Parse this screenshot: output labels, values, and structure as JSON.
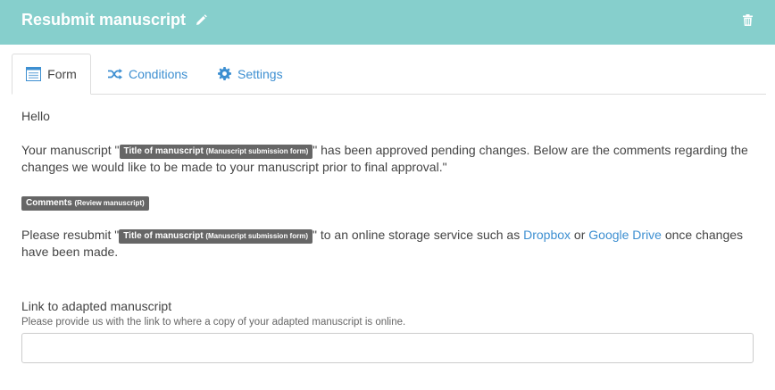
{
  "header": {
    "title": "Resubmit manuscript",
    "edit_icon": "pencil-icon",
    "delete_icon": "trash-icon",
    "background_color": "#86cfcc"
  },
  "tabs": [
    {
      "label": "Form",
      "icon": "form-list-icon",
      "active": true
    },
    {
      "label": "Conditions",
      "icon": "shuffle-icon",
      "active": false
    },
    {
      "label": "Settings",
      "icon": "gear-icon",
      "active": false
    }
  ],
  "body": {
    "greeting": "Hello",
    "para1": {
      "before": "Your manuscript \"",
      "tag_main": "Title of manuscript",
      "tag_sub": "(Manuscript submission form)",
      "after": "\" has been approved pending changes. Below are the comments regarding the changes we would like to be made to your manuscript prior to final approval.\""
    },
    "comments_tag": {
      "main": "Comments",
      "sub": "(Review manuscript)"
    },
    "para2": {
      "before": "Please resubmit \"",
      "tag_main": "Title of manuscript",
      "tag_sub": "(Manuscript submission form)",
      "middle": "\" to an online storage service such as ",
      "link1": "Dropbox",
      "or": " or ",
      "link2": "Google Drive",
      "after": " once changes have been made."
    }
  },
  "field": {
    "label": "Link to adapted manuscript",
    "help": "Please provide us with the link to where a copy of your adapted manuscript is online.",
    "value": "",
    "placeholder": ""
  },
  "colors": {
    "link": "#3d8fd1",
    "tag_bg": "#666666"
  }
}
